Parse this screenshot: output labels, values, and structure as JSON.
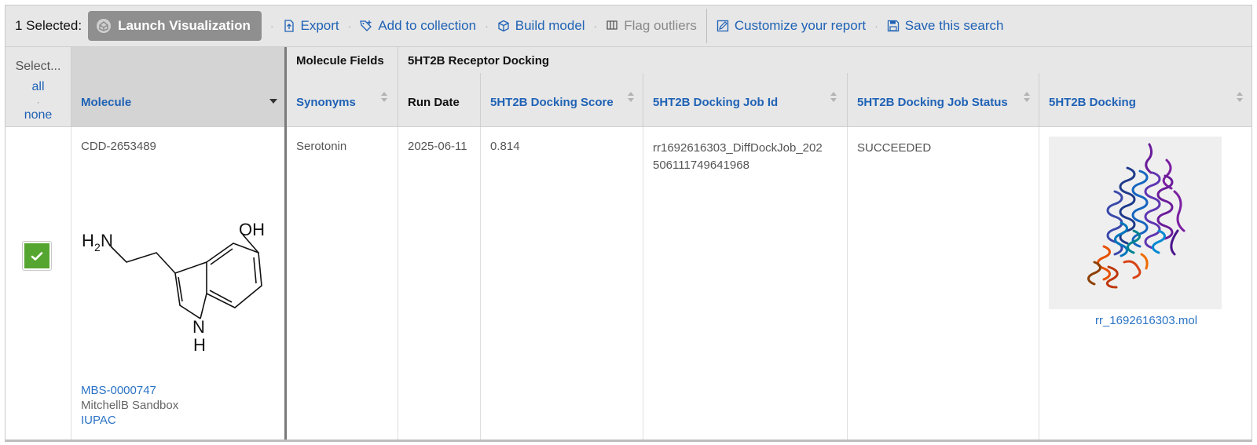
{
  "toolbar": {
    "selected_label": "1 Selected:",
    "launch_label": "Launch Visualization",
    "export_label": "Export",
    "add_collection_label": "Add to collection",
    "build_model_label": "Build model",
    "flag_outliers_label": "Flag outliers",
    "customize_label": "Customize your report",
    "save_search_label": "Save this search"
  },
  "select_header": {
    "title": "Select...",
    "all_label": "all",
    "none_label": "none"
  },
  "groups": {
    "molecule_fields": "Molecule Fields",
    "docking": "5HT2B Receptor Docking"
  },
  "columns": {
    "molecule": "Molecule",
    "synonyms": "Synonyms",
    "run_date": "Run Date",
    "score": "5HT2B Docking Score",
    "job_id": "5HT2B Docking Job Id",
    "job_status": "5HT2B Docking Job Status",
    "docking": "5HT2B Docking"
  },
  "row": {
    "molecule_id": "CDD-2653489",
    "batch_id": "MBS-0000747",
    "project": "MitchellB Sandbox",
    "iupac_label": "IUPAC",
    "atom_oh": "OH",
    "atom_h2n_h": "H",
    "atom_h2n_sub": "2",
    "atom_h2n_n": "N",
    "atom_nh_n": "N",
    "atom_nh_h": "H",
    "synonym": "Serotonin",
    "run_date": "2025-06-11",
    "score": "0.814",
    "job_id_line1": "rr1692616303_DiffDockJob_202",
    "job_id_line2": "506111749641968",
    "job_status": "SUCCEEDED",
    "file_name": "rr_1692616303.mol"
  },
  "colors": {
    "link": "#1f62b5",
    "checkbox": "#55a630",
    "toolbar_bg": "#e7e7e7"
  }
}
